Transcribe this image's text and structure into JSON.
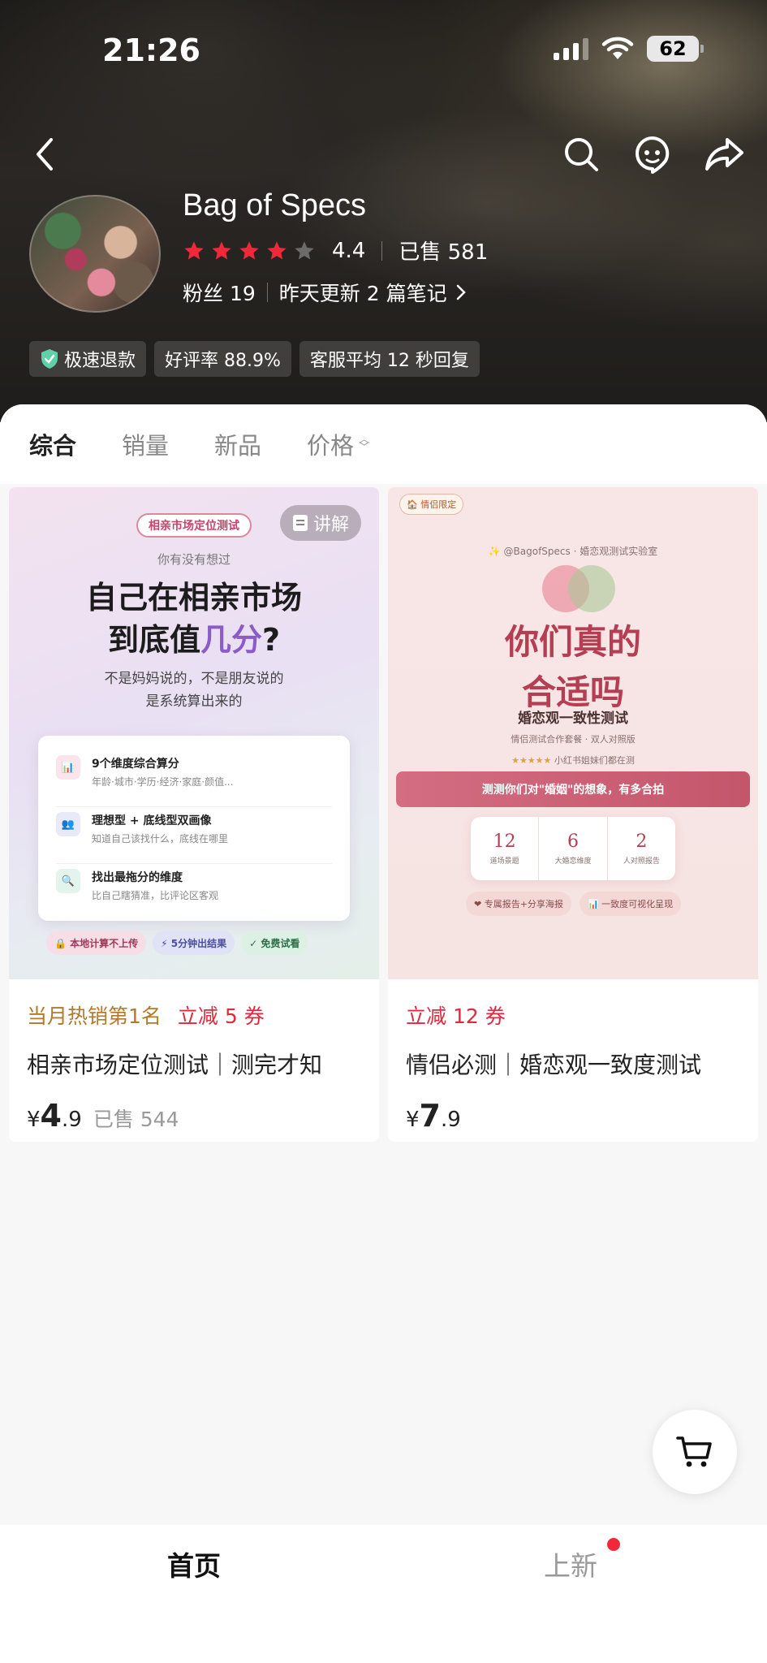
{
  "status_bar": {
    "time": "21:26",
    "battery": "62"
  },
  "shop": {
    "name": "Bag of Specs",
    "rating": "4.4",
    "stars_filled": 4,
    "stars_total": 5,
    "sold": "已售 581",
    "fans": "粉丝 19",
    "update": "昨天更新 2 篇笔记"
  },
  "badges": [
    {
      "label": "极速退款",
      "icon": "shield-check-icon"
    },
    {
      "label": "好评率 88.9%"
    },
    {
      "label": "客服平均 12 秒回复"
    }
  ],
  "tabs": [
    {
      "label": "综合",
      "active": true
    },
    {
      "label": "销量"
    },
    {
      "label": "新品"
    },
    {
      "label": "价格"
    }
  ],
  "products": [
    {
      "thumb": {
        "tag": "相亲市场定位测试",
        "explain": "讲解",
        "question": "你有没有想过",
        "headline1": "自己在相亲市场",
        "headline2a": "到底值",
        "headline2b": "几分",
        "headline2c": "?",
        "sub1": "不是妈妈说的，不是朋友说的",
        "sub2": "是系统算出来的",
        "items": [
          {
            "title": "9个维度综合算分",
            "desc": "年龄·城市·学历·经济·家庭·颜值..."
          },
          {
            "title": "理想型 + 底线型双画像",
            "desc": "知道自己该找什么，底线在哪里"
          },
          {
            "title": "找出最拖分的维度",
            "desc": "比自己瞎猜准，比评论区客观"
          }
        ],
        "pills": [
          "🔒 本地计算不上传",
          "⚡ 5分钟出结果",
          "✓ 免费试看"
        ]
      },
      "promo_hot": "当月热销第1名",
      "promo_cut": "立减 5 券",
      "title": "相亲市场定位测试｜测完才知",
      "price_yen": "¥",
      "price_int": "4",
      "price_dec": ".9",
      "sold": "已售 544"
    },
    {
      "thumb": {
        "tag": "🏠 情侣限定",
        "handle": "✨ @BagofSpecs · 婚恋观测试实验室",
        "headline1": "你们真的",
        "headline2": "合适吗",
        "sub": "婚恋观一致性测试",
        "sub2": "情侣测试合作套餐 · 双人对照版",
        "stars": "★★★★★",
        "sub3": "小红书姐妹们都在测",
        "banner": "测测你们对\"婚姻\"的想象，有多合拍",
        "stats": [
          {
            "num": "12",
            "label": "道场景题"
          },
          {
            "num": "6",
            "label": "大婚恋维度"
          },
          {
            "num": "2",
            "label": "人对照报告"
          }
        ],
        "pills": [
          "❤ 专属报告+分享海报",
          "📊 一致度可视化呈现"
        ]
      },
      "promo_cut": "立减 12 券",
      "title": "情侣必测｜婚恋观一致度测试",
      "price_yen": "¥",
      "price_int": "7",
      "price_dec": ".9"
    }
  ],
  "bottom_nav": {
    "home": "首页",
    "new": "上新"
  },
  "colors": {
    "accent_red": "#e0293f",
    "hot_gold": "#b37a2b",
    "star_red": "#f0283a"
  }
}
